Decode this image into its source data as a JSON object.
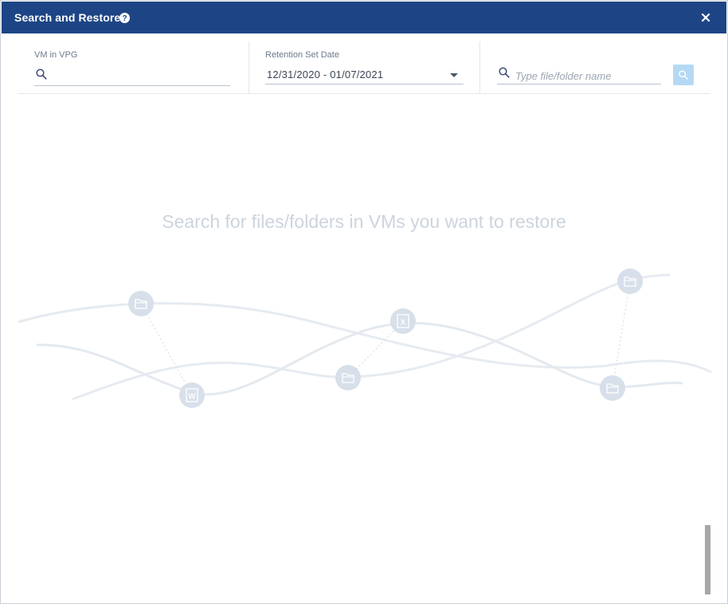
{
  "dialog": {
    "title": "Search and Restore",
    "help_icon": "question-circle-icon",
    "close_icon": "close-icon",
    "header_color": "#1d4585"
  },
  "filters": {
    "vm": {
      "label": "VM in VPG",
      "value": "",
      "icon": "search-icon"
    },
    "retention": {
      "label": "Retention Set Date",
      "value": "12/31/2020 - 01/07/2021",
      "icon": "chevron-down-icon"
    },
    "file": {
      "placeholder": "Type file/folder name",
      "value": "",
      "icon": "search-icon",
      "button_icon": "search-icon",
      "button_color": "#b5d9f4"
    }
  },
  "empty_state": {
    "message": "Search for files/folders in VMs you want to restore",
    "icons": [
      "folder-icon",
      "word-file-icon",
      "folder-icon",
      "excel-file-icon",
      "folder-icon",
      "folder-icon"
    ]
  }
}
